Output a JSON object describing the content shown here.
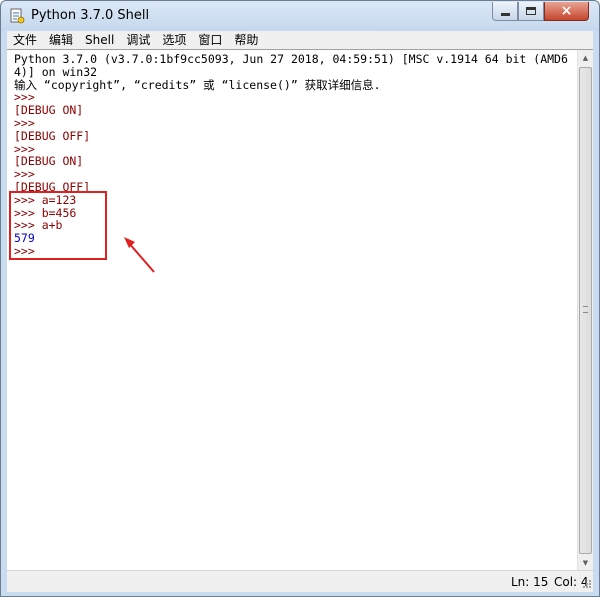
{
  "window": {
    "title": "Python 3.7.0 Shell",
    "close_glyph": "×"
  },
  "menu": {
    "items": [
      "文件",
      "编辑",
      "Shell",
      "调试",
      "选项",
      "窗口",
      "帮助"
    ]
  },
  "shell": {
    "lines": [
      {
        "text": "Python 3.7.0 (v3.7.0:1bf9cc5093, Jun 27 2018, 04:59:51) [MSC v.1914 64 bit (AMD6",
        "color": "black"
      },
      {
        "text": "4)] on win32",
        "color": "black"
      },
      {
        "text": "输入 “copyright”, “credits” 或 “license()” 获取详细信息.",
        "color": "black"
      },
      {
        "text": ">>> ",
        "color": "prompt"
      },
      {
        "text": "[DEBUG ON]",
        "color": "red"
      },
      {
        "text": ">>> ",
        "color": "prompt"
      },
      {
        "text": "[DEBUG OFF]",
        "color": "red"
      },
      {
        "text": ">>> ",
        "color": "prompt"
      },
      {
        "text": "[DEBUG ON]",
        "color": "red"
      },
      {
        "text": ">>> ",
        "color": "prompt"
      },
      {
        "text": "[DEBUG OFF]",
        "color": "red"
      },
      {
        "text": ">>> a=123",
        "color": "prompt"
      },
      {
        "text": ">>> b=456",
        "color": "prompt"
      },
      {
        "text": ">>> a+b",
        "color": "prompt"
      },
      {
        "text": "579",
        "color": "blue"
      },
      {
        "text": ">>> ",
        "color": "prompt"
      }
    ]
  },
  "status": {
    "ln": "Ln: 15",
    "col": "Col: 4"
  },
  "colors": {
    "prompt": "#8b0000",
    "output": "#0000c0",
    "annotation": "#e02020"
  },
  "icons": {
    "app": "python-idle-icon",
    "minimize": "minimize-icon",
    "maximize": "maximize-icon",
    "close": "close-icon",
    "scroll_up": "scroll-up-arrow-icon",
    "scroll_down": "scroll-down-arrow-icon",
    "resize": "resize-grip-icon",
    "annotation": "red-arrow-icon"
  }
}
